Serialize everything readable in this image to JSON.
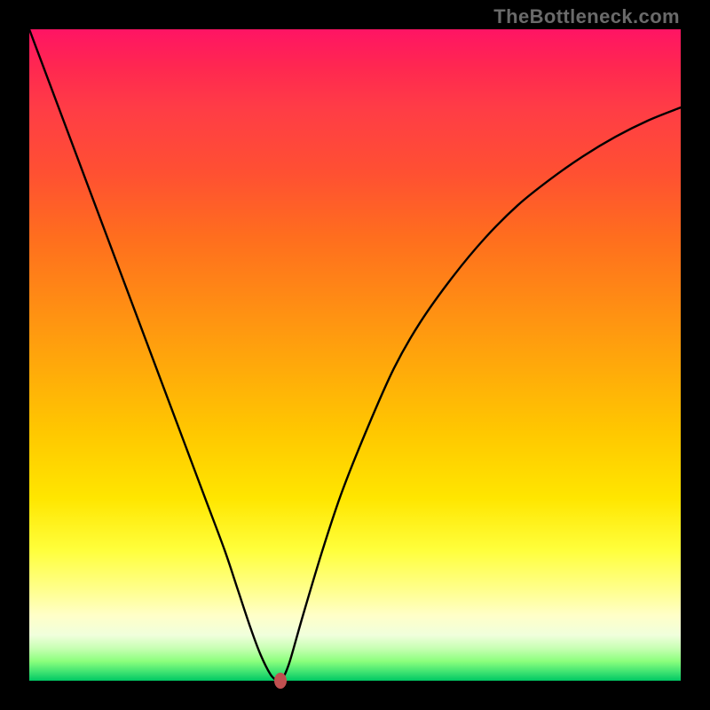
{
  "watermark": "TheBottleneck.com",
  "chart_data": {
    "type": "line",
    "title": "",
    "xlabel": "",
    "ylabel": "",
    "xlim": [
      0,
      100
    ],
    "ylim": [
      0,
      100
    ],
    "x": [
      0,
      3,
      6,
      9,
      12,
      15,
      18,
      21,
      24,
      27,
      30,
      32,
      34,
      35.5,
      37,
      38,
      38.5,
      39,
      40,
      42,
      45,
      48,
      52,
      56,
      60,
      65,
      70,
      75,
      80,
      85,
      90,
      95,
      100
    ],
    "values": [
      100,
      92,
      84,
      76,
      68,
      60,
      52,
      44,
      36,
      28,
      20,
      14,
      8,
      4,
      1,
      0,
      0,
      0.5,
      3,
      10,
      20,
      29,
      39,
      48,
      55,
      62,
      68,
      73,
      77,
      80.5,
      83.5,
      86,
      88
    ],
    "marker": {
      "x": 38.5,
      "y": 0
    },
    "background": "spectrum-vertical (red→orange→yellow→green)",
    "grid": false,
    "legend": false
  }
}
